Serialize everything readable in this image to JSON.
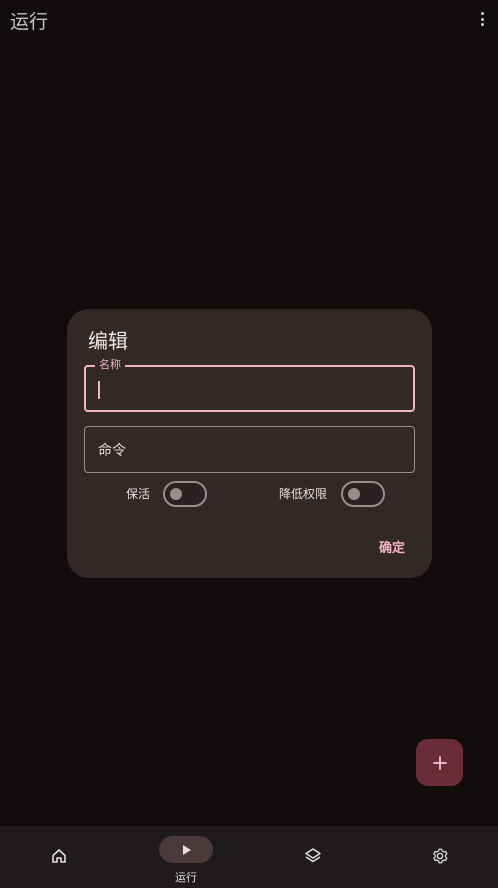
{
  "app_bar": {
    "title": "运行",
    "overflow_icon": "more-vert-icon"
  },
  "dialog": {
    "title": "编辑",
    "name_field": {
      "label": "名称",
      "value": ""
    },
    "command_field": {
      "placeholder": "命令",
      "value": ""
    },
    "keep_alive": {
      "label": "保活",
      "checked": false
    },
    "lower_privilege": {
      "label": "降低权限",
      "checked": false
    },
    "confirm_label": "确定"
  },
  "fab": {
    "icon": "plus-icon"
  },
  "bottom_nav": {
    "items": [
      {
        "icon": "home-icon",
        "label": ""
      },
      {
        "icon": "play-icon",
        "label": "运行",
        "active": true
      },
      {
        "icon": "layers-icon",
        "label": ""
      },
      {
        "icon": "gear-icon",
        "label": ""
      }
    ]
  },
  "colors": {
    "background": "#120c0d",
    "dialog": "#322828",
    "accent": "#f0b3c4",
    "fab": "#6b2c3a",
    "nav_bar": "#1f1a1b"
  }
}
